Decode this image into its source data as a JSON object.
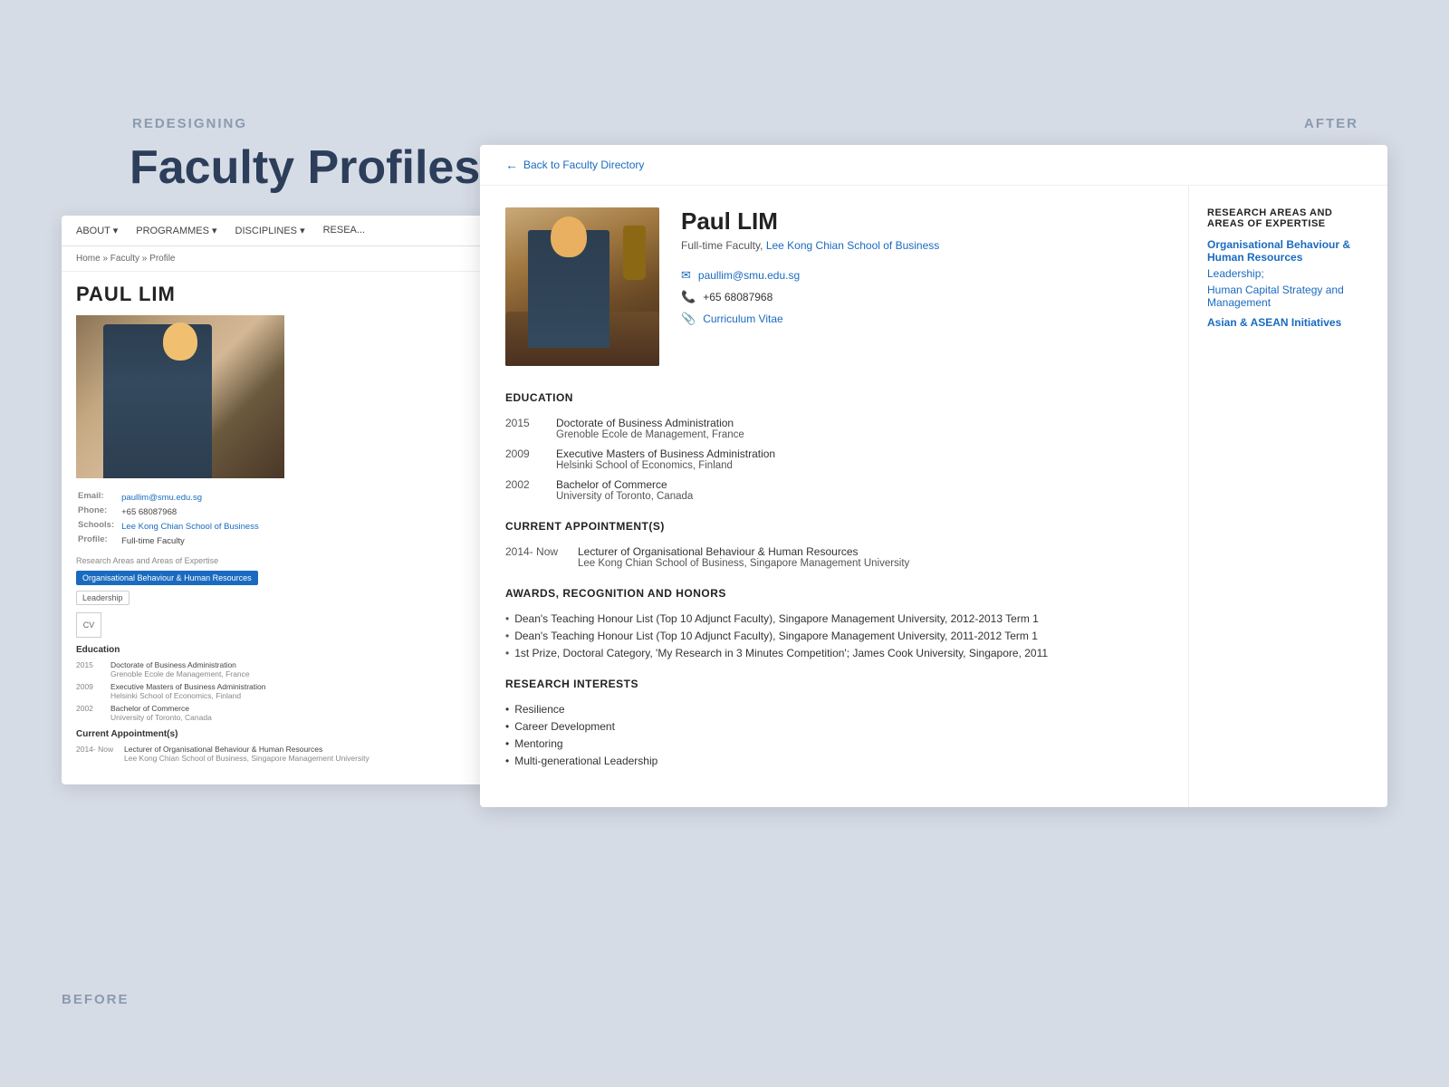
{
  "page": {
    "background_label_redesigning": "REDESIGNING",
    "background_label_faculty_profiles": "Faculty Profiles",
    "label_after": "AFTER",
    "label_before": "BEFORE"
  },
  "before": {
    "nav_items": [
      "ABOUT",
      "PROGRAMMES",
      "DISCIPLINES",
      "RESEA..."
    ],
    "breadcrumb": "Home » Faculty » Profile",
    "name": "PAUL LIM",
    "info": {
      "email_label": "Email:",
      "email": "paullim@smu.edu.sg",
      "phone_label": "Phone:",
      "phone": "+65 68087968",
      "school_label": "Schools:",
      "school": "Lee Kong Chian School of Business",
      "profile_label": "Profile:",
      "profile": "Full-time Faculty"
    },
    "research_label": "Research Areas and Areas of Expertise",
    "tag1": "Organisational Behaviour & Human Resources",
    "tag2": "Leadership",
    "cv_label": "CV",
    "education_title": "Education",
    "education": [
      {
        "year": "2015",
        "degree": "Doctorate of Business Administration",
        "school": "Grenoble Ecole de Management, France"
      },
      {
        "year": "2009",
        "degree": "Executive Masters of Business Administration",
        "school": "Helsinki School of Economics, Finland"
      },
      {
        "year": "2002",
        "degree": "Bachelor of Commerce",
        "school": "University of Toronto, Canada"
      }
    ],
    "appointment_title": "Current Appointment(s)",
    "appointment": {
      "year": "2014- Now",
      "title": "Lecturer of Organisational Behaviour & Human Resources",
      "school": "Lee Kong Chian School of Business, Singapore Management University"
    }
  },
  "after": {
    "back_link": "Back to Faculty Directory",
    "name": "Paul LIM",
    "title": "Full-time Faculty,",
    "school_link": "Lee Kong Chian School of Business",
    "contact": {
      "email": "paullim@smu.edu.sg",
      "phone": "+65 68087968",
      "cv_label": "Curriculum Vitae"
    },
    "research_title": "RESEARCH AREAS AND AREAS OF EXPERTISE",
    "research_areas": [
      {
        "label": "Organisational Behaviour & Human Resources",
        "bold": true
      },
      {
        "label": "Leadership;",
        "bold": false
      },
      {
        "label": "Human Capital Strategy and Management",
        "bold": false
      }
    ],
    "research_area_asian": "Asian & ASEAN Initiatives",
    "sections": {
      "education_title": "EDUCATION",
      "education": [
        {
          "year": "2015",
          "degree": "Doctorate of Business Administration",
          "school": "Grenoble Ecole de Management, France"
        },
        {
          "year": "2009",
          "degree": "Executive Masters of Business Administration",
          "school": "Helsinki School of Economics, Finland"
        },
        {
          "year": "2002",
          "degree": "Bachelor of Commerce",
          "school": "University of Toronto, Canada"
        }
      ],
      "appointment_title": "CURRENT APPOINTMENT(S)",
      "appointments": [
        {
          "period": "2014- Now",
          "role": "Lecturer of Organisational Behaviour & Human Resources",
          "org": "Lee Kong Chian School of Business, Singapore Management University"
        }
      ],
      "awards_title": "AWARDS, RECOGNITION AND HONORS",
      "awards": [
        "Dean's Teaching Honour List (Top 10 Adjunct Faculty), Singapore Management University, 2012-2013 Term 1",
        "Dean's Teaching Honour List (Top 10 Adjunct Faculty), Singapore Management University, 2011-2012 Term 1",
        "1st Prize, Doctoral Category, 'My Research in 3 Minutes Competition'; James Cook University, Singapore, 2011"
      ],
      "interests_title": "RESEARCH INTERESTS",
      "interests": [
        "Resilience",
        "Career Development",
        "Mentoring",
        "Multi-generational Leadership"
      ]
    }
  }
}
